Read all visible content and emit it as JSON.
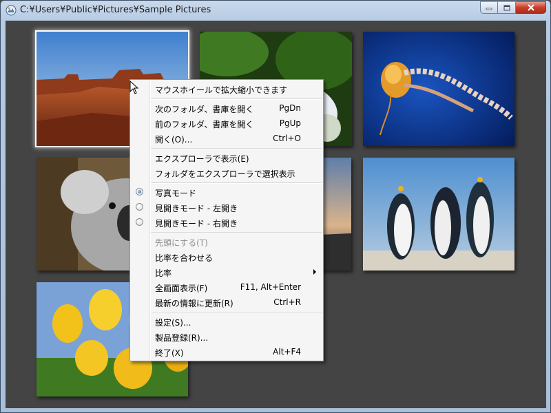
{
  "window": {
    "title": "C:¥Users¥Public¥Pictures¥Sample Pictures",
    "buttons": {
      "minimize": "minimize-icon",
      "maximize": "maximize-icon",
      "close": "close-icon"
    }
  },
  "thumbnails": [
    {
      "name": "desert",
      "icon": "photo"
    },
    {
      "name": "hydrangeas",
      "icon": "photo"
    },
    {
      "name": "jellyfish",
      "icon": "photo"
    },
    {
      "name": "koala",
      "icon": "photo"
    },
    {
      "name": "lighthouse",
      "icon": "photo"
    },
    {
      "name": "penguins",
      "icon": "photo"
    },
    {
      "name": "tulips",
      "icon": "photo"
    }
  ],
  "menu": {
    "hint": "マウスホイールで拡大縮小できます",
    "next_folder": {
      "label": "次のフォルダ、書庫を開く",
      "shortcut": "PgDn"
    },
    "prev_folder": {
      "label": "前のフォルダ、書庫を開く",
      "shortcut": "PgUp"
    },
    "open": {
      "label": "開く(O)...",
      "shortcut": "Ctrl+O"
    },
    "explorer_show": {
      "label": "エクスプローラで表示(E)"
    },
    "explorer_select": {
      "label": "フォルダをエクスプローラで選択表示"
    },
    "photo_mode": {
      "label": "写真モード",
      "checked": true
    },
    "spread_left": {
      "label": "見開きモード - 左開き",
      "checked": false
    },
    "spread_right": {
      "label": "見開きモード - 右開き",
      "checked": false
    },
    "set_first": {
      "label": "先頭にする(T)",
      "enabled": false
    },
    "fit_ratio": {
      "label": "比率を合わせる"
    },
    "ratio": {
      "label": "比率"
    },
    "fullscreen": {
      "label": "全画面表示(F)",
      "shortcut": "F11, Alt+Enter"
    },
    "refresh": {
      "label": "最新の情報に更新(R)",
      "shortcut": "Ctrl+R"
    },
    "settings": {
      "label": "設定(S)..."
    },
    "register": {
      "label": "製品登録(R)..."
    },
    "exit": {
      "label": "終了(X)",
      "shortcut": "Alt+F4"
    }
  },
  "colors": {
    "background": "#444444",
    "menu_bg": "#f5f5f5",
    "disabled_text": "#8d8d8d"
  }
}
